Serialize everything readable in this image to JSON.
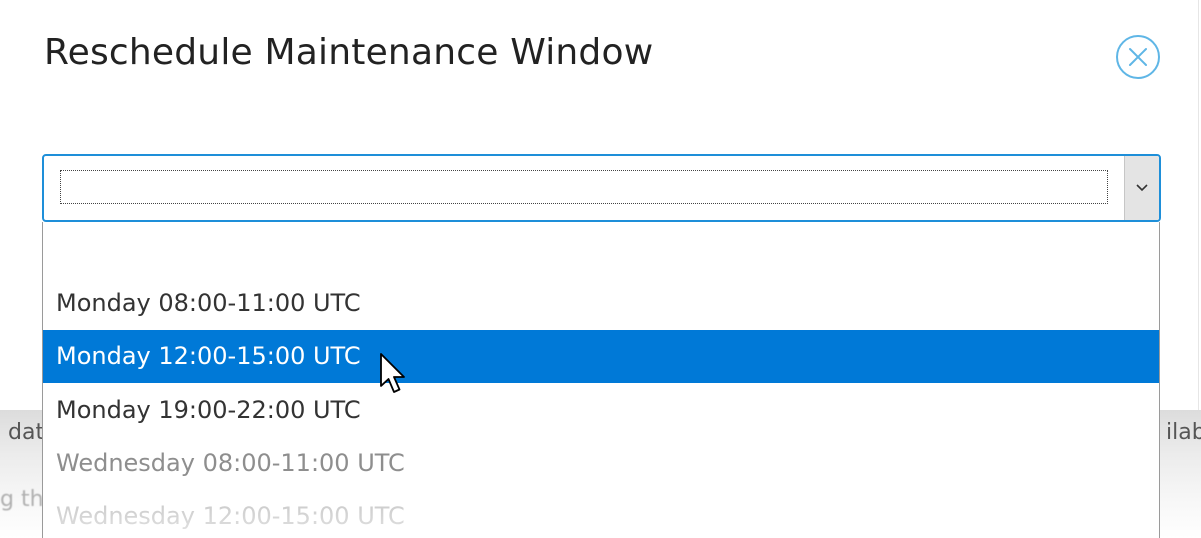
{
  "background": {
    "text_left_1": "dat",
    "text_left_2": "g th",
    "text_right_1": "ilab"
  },
  "dialog": {
    "title": "Reschedule Maintenance Window",
    "close_icon": "close-circle-icon"
  },
  "select": {
    "value": "",
    "arrow_icon": "chevron-down-icon"
  },
  "dropdown": {
    "options": [
      "",
      "Monday 08:00-11:00 UTC",
      "Monday 12:00-15:00 UTC",
      "Monday 19:00-22:00 UTC",
      "Wednesday 08:00-11:00 UTC",
      "Wednesday 12:00-15:00 UTC"
    ],
    "highlighted_index": 2
  },
  "colors": {
    "accent": "#1e8fd9",
    "highlight": "#0079d7",
    "close_icon": "#5fb6e6"
  }
}
